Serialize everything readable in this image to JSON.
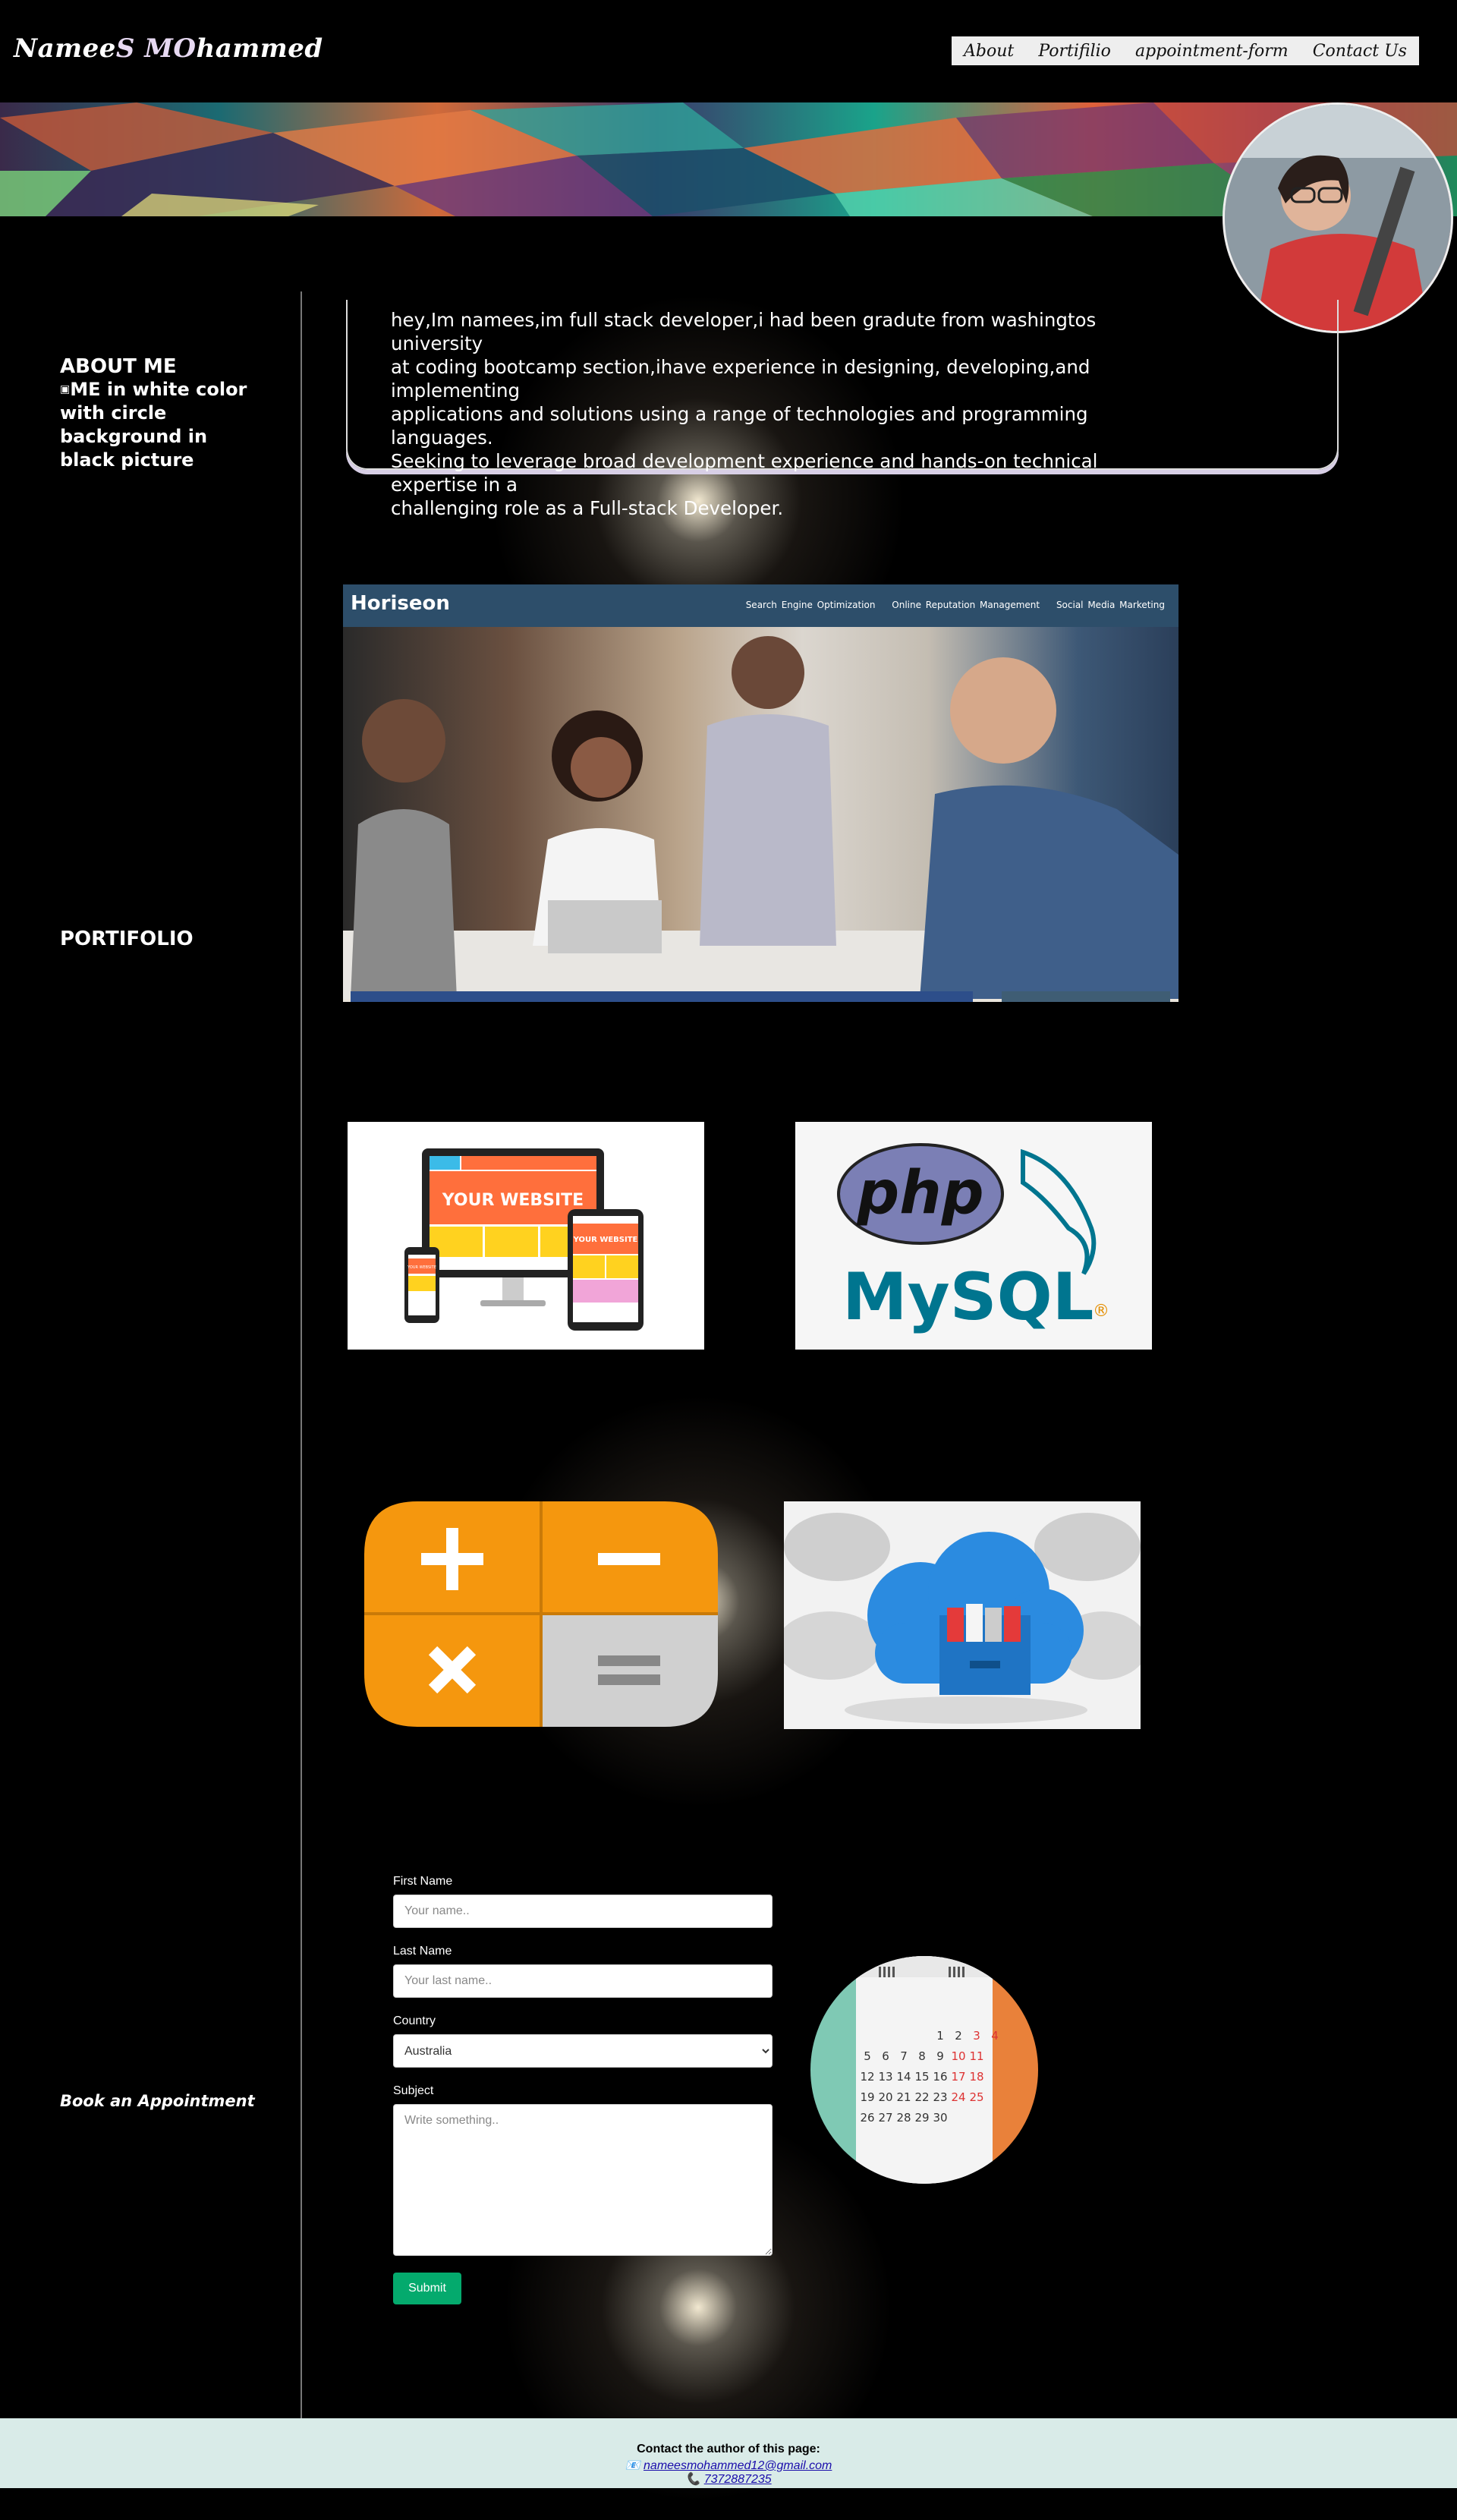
{
  "header": {
    "logo_part1": "Namee",
    "logo_part2": "S ",
    "logo_part3": "MO",
    "logo_part4": "hammed",
    "nav": [
      "About",
      "Portifilio",
      "appointment-form",
      "Contact Us"
    ]
  },
  "about": {
    "section_title": "ABOUT ME",
    "image_alt": "ME in white color with circle background in black picture",
    "lines": [
      "hey,Im namees,im full stack developer,i had been gradute from washingtos university",
      "at coding bootcamp section,ihave  experience in designing, developing,and implementing",
      "applications and solutions using a range of technologies and programming languages.",
      "Seeking to leverage broad development experience and hands-on technical expertise in a",
      "challenging role as a Full-stack Developer."
    ]
  },
  "portfolio": {
    "section_title": "PORTIFOLIO",
    "screenshot": {
      "brand": "Horiseon",
      "links": [
        "Search Engine Optimization",
        "Online Reputation Management",
        "Social Media Marketing"
      ]
    },
    "web_thumb": {
      "text1": "YOUR WEBSITE",
      "text2": "YOUR WEBSITE",
      "text3": "YOUR WEBSITE"
    },
    "php_thumb": {
      "text1": "php",
      "text2": "MySQL",
      "reg": "®"
    }
  },
  "appointment": {
    "section_title": "Book an Appointment",
    "first_name_label": "First Name",
    "first_name_placeholder": "Your name..",
    "last_name_label": "Last Name",
    "last_name_placeholder": "Your last name..",
    "country_label": "Country",
    "country_value": "Australia",
    "subject_label": "Subject",
    "subject_placeholder": "Write something..",
    "submit_label": "Submit",
    "calendar_rows": [
      [
        "",
        "",
        "",
        "",
        "1",
        "2",
        "3",
        "4"
      ],
      [
        "5",
        "6",
        "7",
        "8",
        "9",
        "10",
        "11"
      ],
      [
        "12",
        "13",
        "14",
        "15",
        "16",
        "17",
        "18"
      ],
      [
        "19",
        "20",
        "21",
        "22",
        "23",
        "24",
        "25"
      ],
      [
        "26",
        "27",
        "28",
        "29",
        "30"
      ]
    ]
  },
  "footer": {
    "title": "Contact the author of this page:",
    "email_icon": "envelope-icon",
    "email": "nameesmohammed12@gmail.com",
    "phone_icon": "phone-icon",
    "phone": "7372887235"
  },
  "colors": {
    "background": "#000000",
    "nav_bg": "#eeeeee",
    "submit_bg": "#04AA6D",
    "footer_bg": "#d9ebe8",
    "link": "#1a0dab"
  }
}
